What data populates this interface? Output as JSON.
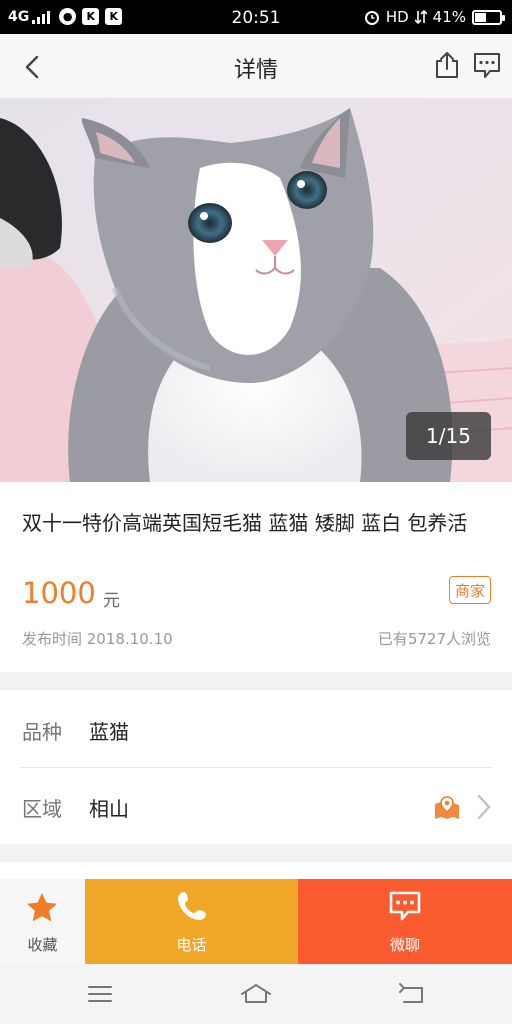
{
  "status_bar": {
    "network": "4G",
    "time": "20:51",
    "hd": "HD",
    "battery_text": "41%",
    "battery_level": 0.41,
    "app_icons": [
      "wechat-icon",
      "k-icon",
      "k-icon"
    ]
  },
  "header": {
    "title": "详情",
    "icons": [
      "back-arrow-icon",
      "share-icon",
      "message-icon"
    ]
  },
  "gallery": {
    "counter": "1/15"
  },
  "listing": {
    "title": "双十一特价高端英国短毛猫 蓝猫 矮脚 蓝白 包养活",
    "price": "1000",
    "unit": "元",
    "badge": "商家",
    "publish_date": "发布时间 2018.10.10",
    "views": "已有5727人浏览"
  },
  "details": {
    "breed_label": "品种",
    "breed_value": "蓝猫",
    "area_label": "区域",
    "area_value": "相山"
  },
  "actions": {
    "favorite": "收藏",
    "call": "电话",
    "chat": "微聊"
  },
  "colors": {
    "accent": "#f07d2b",
    "call_bg": "#f0a626",
    "chat_bg": "#fc5a2f"
  }
}
